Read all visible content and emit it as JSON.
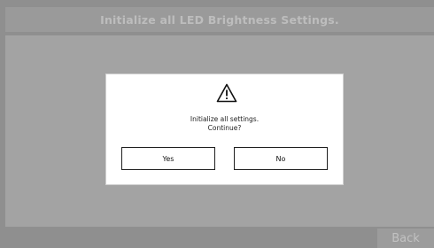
{
  "header": {
    "title": "Initialize all LED Brightness Settings."
  },
  "dialog": {
    "icon": "warning-icon",
    "message_line1": "Initialize all settings.",
    "message_line2": "Continue?",
    "yes_label": "Yes",
    "no_label": "No"
  },
  "footer": {
    "back_label": "Back"
  },
  "colors": {
    "overlay_background": "#8f8f8f",
    "dialog_background": "#ffffff",
    "button_border": "#1f1f1f"
  }
}
